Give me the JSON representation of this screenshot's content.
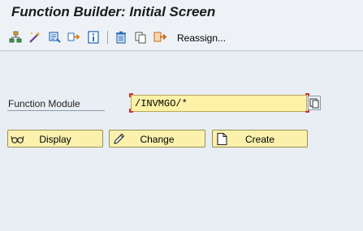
{
  "window": {
    "title": "Function Builder: Initial Screen"
  },
  "toolbar": {
    "icons": [
      "hierarchy-icon",
      "magic-wand-icon",
      "test-icon",
      "where-used-icon",
      "info-icon",
      "delete-icon",
      "copy-icon",
      "rename-icon"
    ],
    "reassign_label": "Reassign..."
  },
  "form": {
    "function_module_label": "Function Module",
    "function_module_value": "/INVMGO/*"
  },
  "buttons": {
    "display_label": "Display",
    "change_label": "Change",
    "create_label": "Create"
  },
  "colors": {
    "input_background": "#fdf2a6",
    "button_background": "#fbf1ad",
    "required_marker": "#d2322d",
    "toolbar_icon_blue": "#2c6fb7"
  }
}
